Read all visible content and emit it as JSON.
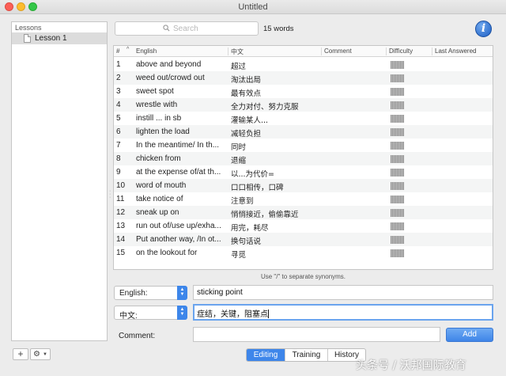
{
  "window": {
    "title": "Untitled"
  },
  "sidebar": {
    "header": "Lessons",
    "items": [
      {
        "label": "Lesson 1"
      }
    ],
    "add_label": "+",
    "gear_label": "⚙"
  },
  "search": {
    "placeholder": "Search"
  },
  "word_count": "15 words",
  "info_label": "i",
  "table": {
    "columns": [
      "#",
      "English",
      "中文",
      "Comment",
      "Difficulty",
      "Last Answered"
    ],
    "rows": [
      {
        "num": "1",
        "en": "above and beyond",
        "zh": "超过"
      },
      {
        "num": "2",
        "en": "weed out/crowd out",
        "zh": "淘汰出局"
      },
      {
        "num": "3",
        "en": "sweet spot",
        "zh": "最有效点"
      },
      {
        "num": "4",
        "en": "wrestle with",
        "zh": "全力对付、努力克服"
      },
      {
        "num": "5",
        "en": "instill ... in sb",
        "zh": "灌输某人..."
      },
      {
        "num": "6",
        "en": "lighten the load",
        "zh": "减轻负担"
      },
      {
        "num": "7",
        "en": "In the meantime/ In th...",
        "zh": "同时"
      },
      {
        "num": "8",
        "en": "chicken from",
        "zh": "退缩"
      },
      {
        "num": "9",
        "en": "at the expense of/at th...",
        "zh": "以...为代价="
      },
      {
        "num": "10",
        "en": "word of mouth",
        "zh": "口口相传，口碑"
      },
      {
        "num": "11",
        "en": "take notice of",
        "zh": "注意到"
      },
      {
        "num": "12",
        "en": "sneak up on",
        "zh": "悄悄接近，偷偷靠近"
      },
      {
        "num": "13",
        "en": "run out of/use up/exha...",
        "zh": "用完，耗尽"
      },
      {
        "num": "14",
        "en": "Put another way, /In ot...",
        "zh": "换句话说"
      },
      {
        "num": "15",
        "en": "on the lookout for",
        "zh": " 寻觅"
      }
    ]
  },
  "hint": "Use \"/\" to separate synonyms.",
  "editor": {
    "english_select": "English:",
    "english_value": "sticking point",
    "chinese_select": "中文:",
    "chinese_value": "症结，关键，阻塞点",
    "comment_label": "Comment:",
    "comment_value": "",
    "add_label": "Add"
  },
  "modes": [
    {
      "label": "Editing",
      "active": true
    },
    {
      "label": "Training",
      "active": false
    },
    {
      "label": "History",
      "active": false
    }
  ],
  "watermark": "头条号 / 沃邦国际教育"
}
